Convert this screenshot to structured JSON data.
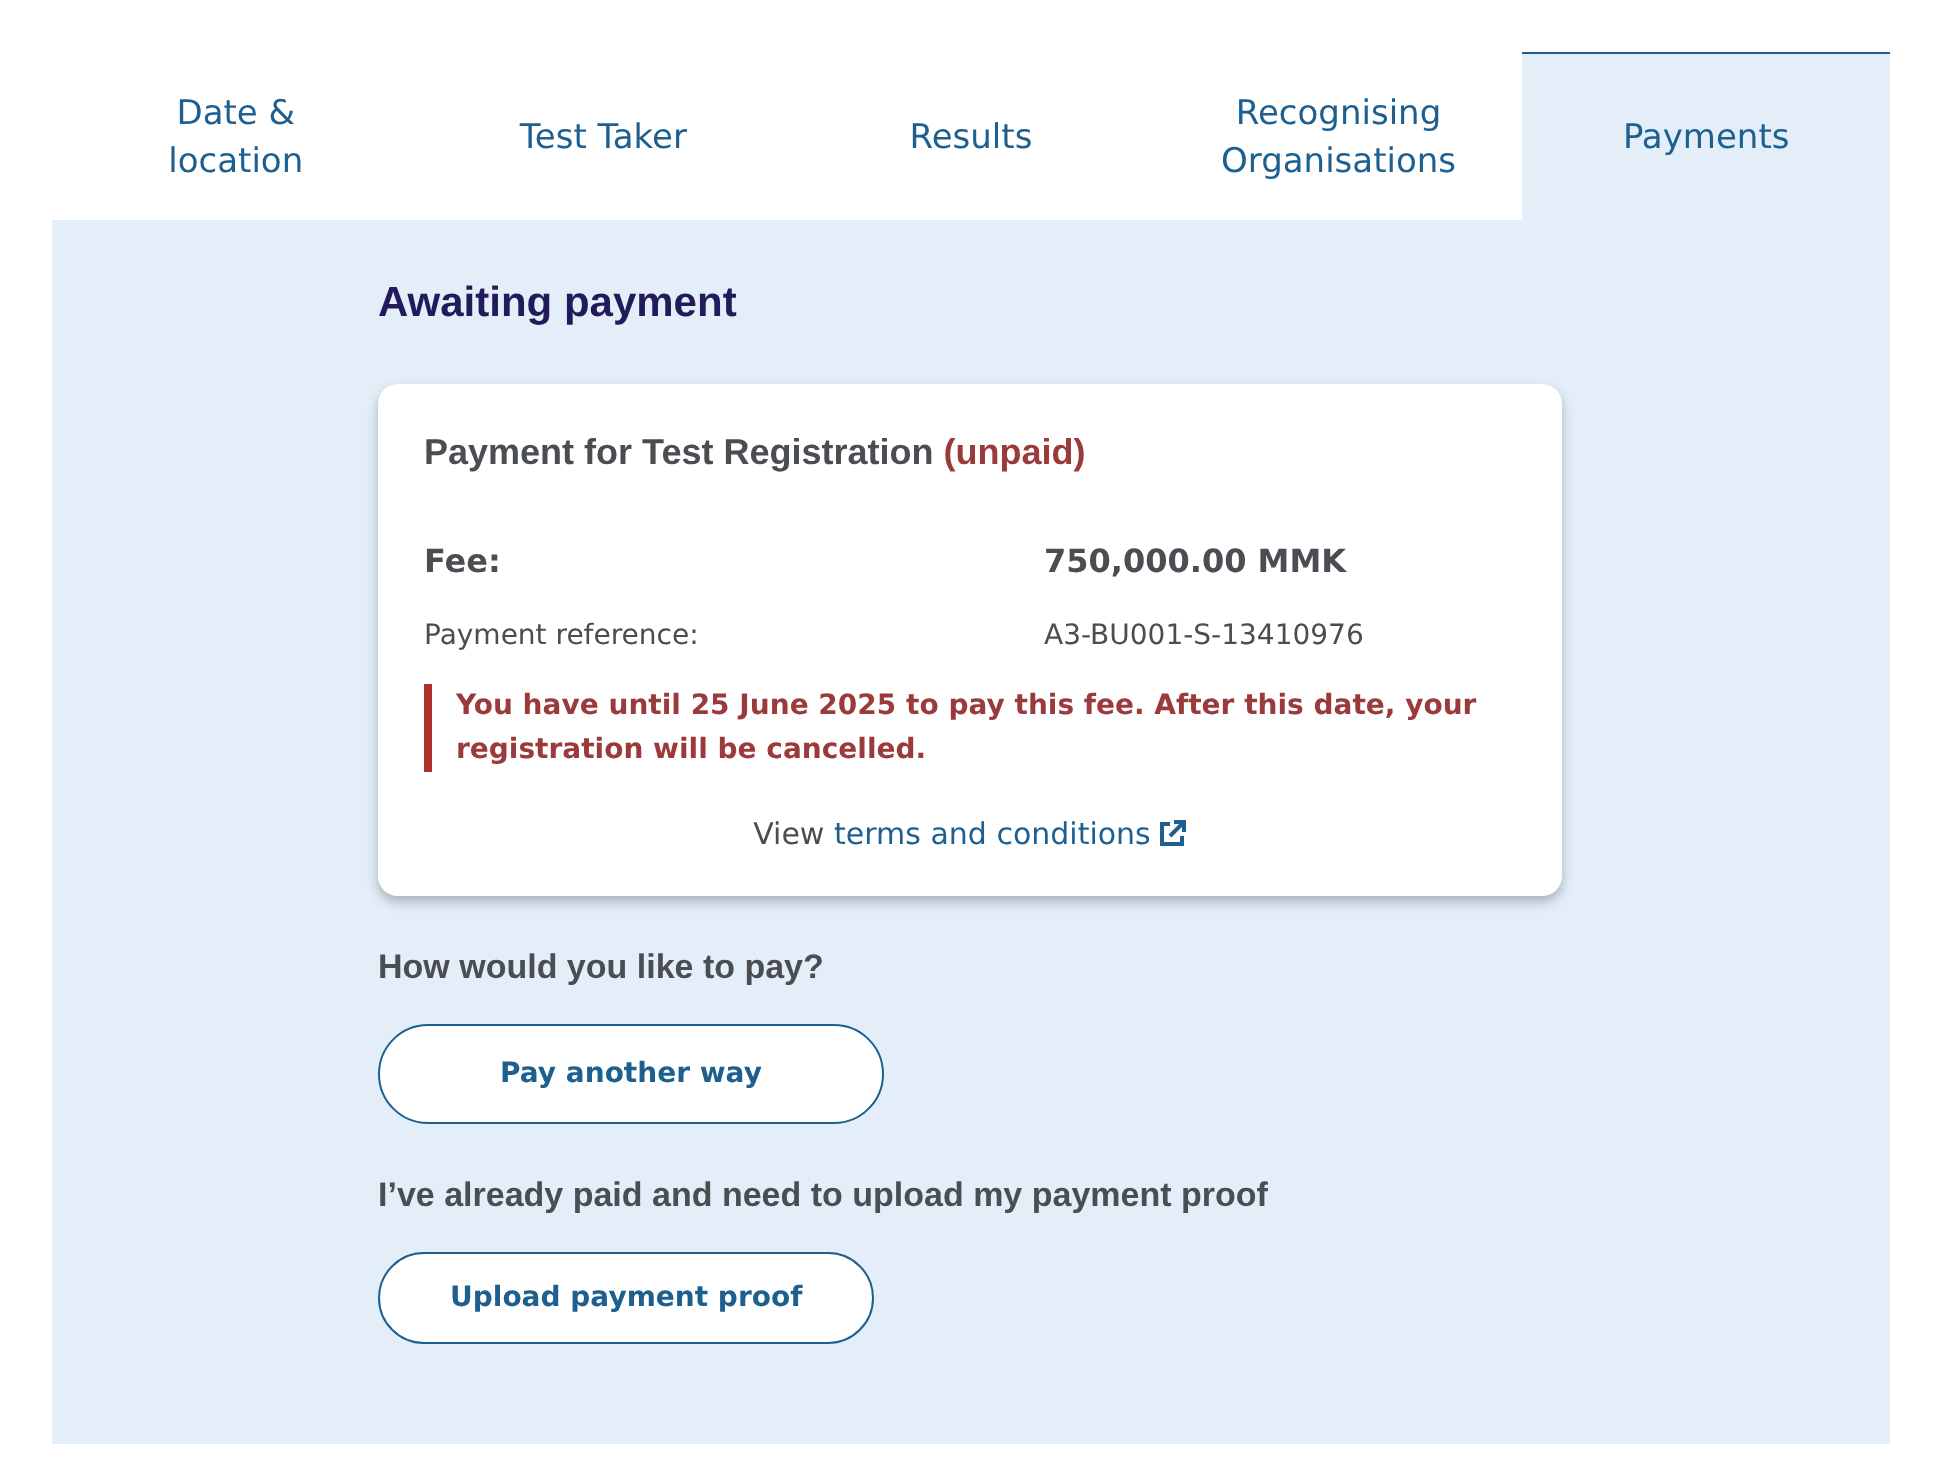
{
  "tabs": [
    {
      "label": "Date & location",
      "selected": false
    },
    {
      "label": "Test Taker",
      "selected": false
    },
    {
      "label": "Results",
      "selected": false
    },
    {
      "label": "Recognising Organisations",
      "selected": false
    },
    {
      "label": "Payments",
      "selected": true
    }
  ],
  "heading": "Awaiting payment",
  "card": {
    "title": "Payment for Test Registration",
    "status": "(unpaid)",
    "rows": [
      {
        "kind": "strong",
        "label": "Fee:",
        "value": "750,000.00 MMK"
      },
      {
        "kind": "plain",
        "label": "Payment reference:",
        "value": "A3-BU001-S-13410976"
      }
    ],
    "warning": "You have until 25 June 2025 to pay this fee. After this date, your registration will be cancelled.",
    "terms_prefix": "View",
    "terms_link": "terms and conditions"
  },
  "sections": [
    {
      "question": "How would you like to pay?",
      "button": "Pay another way"
    },
    {
      "question": "I’ve already paid and need to upload my payment proof",
      "button": "Upload payment proof"
    }
  ]
}
